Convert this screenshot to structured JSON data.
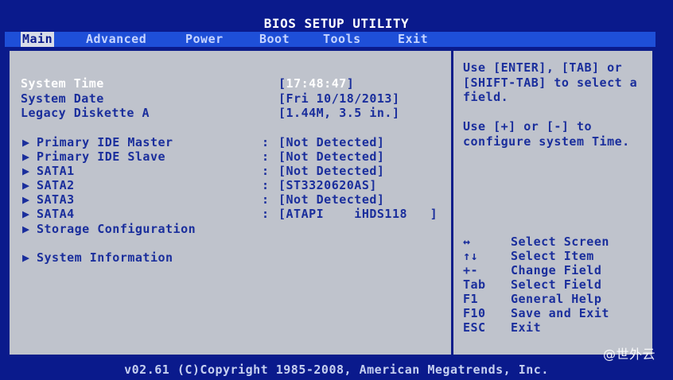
{
  "title": "BIOS SETUP UTILITY",
  "menu": {
    "items": [
      "Main",
      "Advanced",
      "Power",
      "Boot",
      "Tools",
      "Exit"
    ],
    "active": "Main"
  },
  "settings": {
    "system_time_label": "System Time",
    "system_time_value_open": "[",
    "system_time_value_hl": "17:48:47",
    "system_time_value_close": "]",
    "system_date_label": "System Date",
    "system_date_value": "[Fri 10/18/2013]",
    "legacy_diskette_label": "Legacy Diskette A",
    "legacy_diskette_value": "[1.44M, 3.5 in.]"
  },
  "devices": [
    {
      "label": "Primary IDE Master",
      "value": "[Not Detected]"
    },
    {
      "label": "Primary IDE Slave",
      "value": "[Not Detected]"
    },
    {
      "label": "SATA1",
      "value": "[Not Detected]"
    },
    {
      "label": "SATA2",
      "value": "[ST3320620AS]"
    },
    {
      "label": "SATA3",
      "value": "[Not Detected]"
    },
    {
      "label": "SATA4",
      "value": "[ATAPI    iHDS118   ]"
    }
  ],
  "submenus": {
    "storage_configuration": "Storage Configuration",
    "system_information": "System Information"
  },
  "help": {
    "line1": "Use [ENTER], [TAB] or [SHIFT-TAB] to select a field.",
    "line2": "Use [+] or [-] to configure system Time."
  },
  "keys": [
    {
      "key": "↔",
      "desc": "Select Screen"
    },
    {
      "key": "↑↓",
      "desc": "Select Item"
    },
    {
      "key": "+-",
      "desc": "Change Field"
    },
    {
      "key": "Tab",
      "desc": "Select Field"
    },
    {
      "key": "F1",
      "desc": "General Help"
    },
    {
      "key": "F10",
      "desc": "Save and Exit"
    },
    {
      "key": "ESC",
      "desc": "Exit"
    }
  ],
  "footer": "v02.61 (C)Copyright 1985-2008, American Megatrends, Inc.",
  "watermark": "@世外云",
  "colors": {
    "background": "#0a1a8c",
    "menubar": "#1e4fd8",
    "panel": "#bfc3cc",
    "text": "#1a2e9c",
    "highlight": "#ffffff"
  },
  "icons": {
    "submenu_arrow": "triangle-right-icon"
  }
}
